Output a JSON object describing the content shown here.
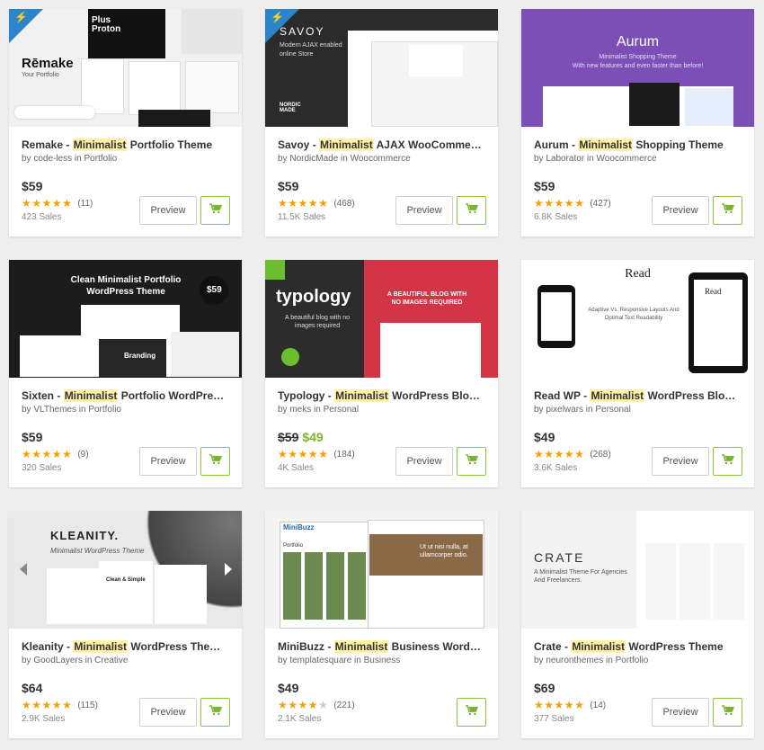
{
  "colors": {
    "accent": "#79b530",
    "highlight": "#fff2a8",
    "star": "#f0a202"
  },
  "preview_label": "Preview",
  "items": [
    {
      "name": "Remake - ",
      "keyword": "Minimalist",
      "rest": " Portfolio Theme",
      "author": "code-less",
      "category": "Portfolio",
      "price": "$59",
      "old_price": "",
      "stars": 5,
      "reviews": "(11)",
      "sales": "423 Sales",
      "has_preview": true,
      "thumb": {
        "bg": "#f1f1f1",
        "title": "Rēmake",
        "subtitle": "Your Portfolio",
        "tagline": "Plus Proton",
        "has_ribbon": true
      }
    },
    {
      "name": "Savoy - ",
      "keyword": "Minimalist",
      "rest": " AJAX WooCommerce Theme",
      "author": "NordicMade",
      "category": "Woocommerce",
      "price": "$59",
      "old_price": "",
      "stars": 5,
      "reviews": "(468)",
      "sales": "11.5K Sales",
      "has_preview": true,
      "thumb": {
        "bg": "#2b2b2b",
        "title": "SAVOY",
        "subtitle": "Modern AJAX enabled online Store",
        "tagline": "NORDIC MADE",
        "has_ribbon": true
      }
    },
    {
      "name": "Aurum - ",
      "keyword": "Minimalist",
      "rest": " Shopping Theme",
      "author": "Laborator",
      "category": "Woocommerce",
      "price": "$59",
      "old_price": "",
      "stars": 5,
      "reviews": "(427)",
      "sales": "6.8K Sales",
      "has_preview": true,
      "thumb": {
        "bg": "#7b4fb6",
        "title": "Aurum",
        "subtitle": "Minimalist Shopping Theme",
        "tagline": "With new features and even faster than before!",
        "has_ribbon": false
      }
    },
    {
      "name": "Sixten - ",
      "keyword": "Minimalist",
      "rest": " Portfolio WordPress Theme",
      "author": "VLThemes",
      "category": "Portfolio",
      "price": "$59",
      "old_price": "",
      "stars": 5,
      "reviews": "(9)",
      "sales": "320 Sales",
      "has_preview": true,
      "thumb": {
        "bg": "#1c1c1c",
        "title": "Clean Minimalist Portfolio WordPress Theme",
        "subtitle": "Branding",
        "tagline": "$59",
        "has_ribbon": false
      }
    },
    {
      "name": "Typology - ",
      "keyword": "Minimalist",
      "rest": " WordPress Blog & Text-based Theme",
      "author": "meks",
      "category": "Personal",
      "price": "$49",
      "old_price": "$59",
      "stars": 5,
      "reviews": "(184)",
      "sales": "4K Sales",
      "has_preview": true,
      "thumb": {
        "bg": "#2c2c2c",
        "title": "typology",
        "subtitle": "A beautiful blog with no images required",
        "tagline": "A BEAUTIFUL BLOG WITH NO IMAGES REQUIRED",
        "has_ribbon": false
      }
    },
    {
      "name": "Read WP - ",
      "keyword": "Minimalist",
      "rest": " WordPress Blog Theme",
      "author": "pixelwars",
      "category": "Personal",
      "price": "$49",
      "old_price": "",
      "stars": 5,
      "reviews": "(268)",
      "sales": "3.6K Sales",
      "has_preview": true,
      "thumb": {
        "bg": "#ffffff",
        "title": "Read",
        "subtitle": "Adaptive Vs. Responsive Layouts And Optimal Text Readability",
        "tagline": "Read",
        "has_ribbon": false
      }
    },
    {
      "name": "Kleanity - ",
      "keyword": "Minimalist",
      "rest": " WordPress Theme / Blog",
      "author": "GoodLayers",
      "category": "Creative",
      "price": "$64",
      "old_price": "",
      "stars": 5,
      "reviews": "(115)",
      "sales": "2.9K Sales",
      "has_preview": true,
      "thumb": {
        "bg": "#e9e9e9",
        "title": "KLEANITY.",
        "subtitle": "Minimalist WordPress Theme",
        "tagline": "Clean & Simple",
        "has_ribbon": false
      }
    },
    {
      "name": "MiniBuzz - ",
      "keyword": "Minimalist",
      "rest": " Business WordPress Theme",
      "author": "templatesquare",
      "category": "Business",
      "price": "$49",
      "old_price": "",
      "stars": 4,
      "reviews": "(221)",
      "sales": "2.1K Sales",
      "has_preview": false,
      "thumb": {
        "bg": "#f4f4f4",
        "title": "MiniBuzz",
        "subtitle": "Portfolio",
        "tagline": "Ut ut nisi nulla, at ullamcorper odio.",
        "has_ribbon": false
      }
    },
    {
      "name": "Crate - ",
      "keyword": "Minimalist",
      "rest": " WordPress Theme",
      "author": "neuronthemes",
      "category": "Portfolio",
      "price": "$69",
      "old_price": "",
      "stars": 5,
      "reviews": "(14)",
      "sales": "377 Sales",
      "has_preview": true,
      "thumb": {
        "bg": "#f2f2f2",
        "title": "CRATE",
        "subtitle": "A Minimalist Theme For Agencies And Freelancers.",
        "tagline": "",
        "has_ribbon": false
      }
    }
  ]
}
